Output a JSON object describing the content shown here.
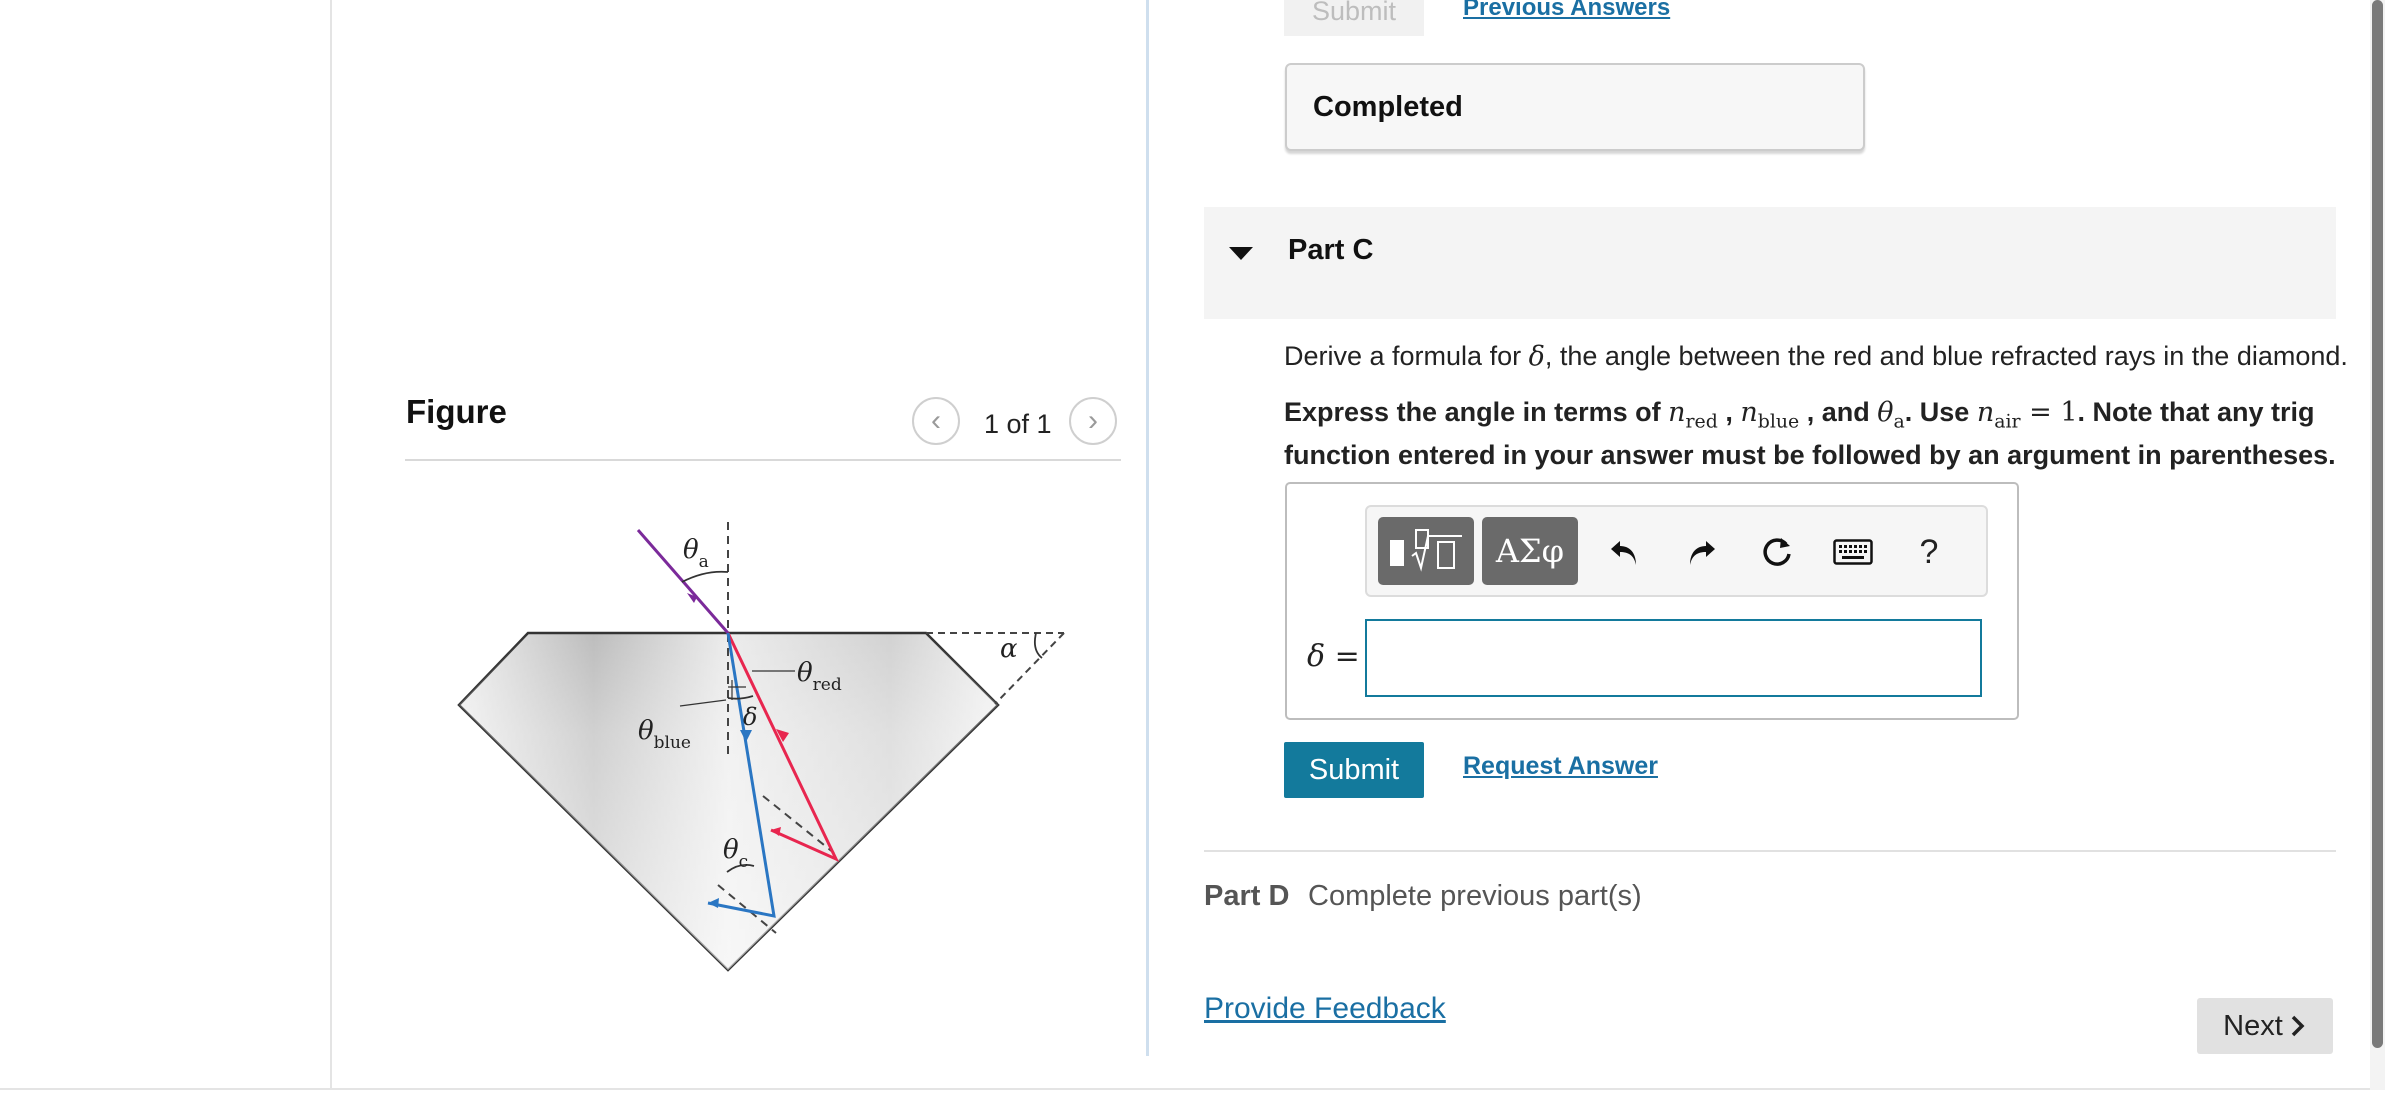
{
  "figure": {
    "title": "Figure",
    "counter": "1 of 1",
    "labels": {
      "theta": "θ",
      "sub_a": "a",
      "sub_red": "red",
      "sub_blue": "blue",
      "sub_c": "c",
      "delta": "δ",
      "alpha": "α"
    }
  },
  "top": {
    "submit_label": "Submit",
    "previous_answers": "Previous Answers",
    "completed": "Completed"
  },
  "part_c": {
    "title": "Part C",
    "question_prefix": "Derive a formula for ",
    "question_symbol": "δ",
    "question_suffix": ", the angle between the red and blue refracted rays in the diamond.",
    "instruction": {
      "t1": "Express the angle in terms of ",
      "n": "n",
      "red": "red",
      "blue": "blue",
      "comma": " , ",
      "and": " , and ",
      "theta": "θ",
      "a": "a",
      "use": ". Use ",
      "air": "air",
      "equals": " = 1",
      "rest": ". Note that any trig function entered in your answer must be followed by an argument in parentheses."
    },
    "answer_label": "δ =",
    "answer_value": "",
    "toolbar": {
      "greek": "ΑΣφ",
      "help": "?"
    },
    "submit_label": "Submit",
    "request_answer": "Request Answer"
  },
  "part_d": {
    "label": "Part D",
    "text": "Complete previous part(s)"
  },
  "footer": {
    "feedback": "Provide Feedback",
    "next": "Next"
  },
  "colors": {
    "accent": "#137a9c",
    "link": "#1a6fa3",
    "red_ray": "#e8264f",
    "blue_ray": "#2a76c3",
    "incident_ray": "#7b2a9a"
  }
}
